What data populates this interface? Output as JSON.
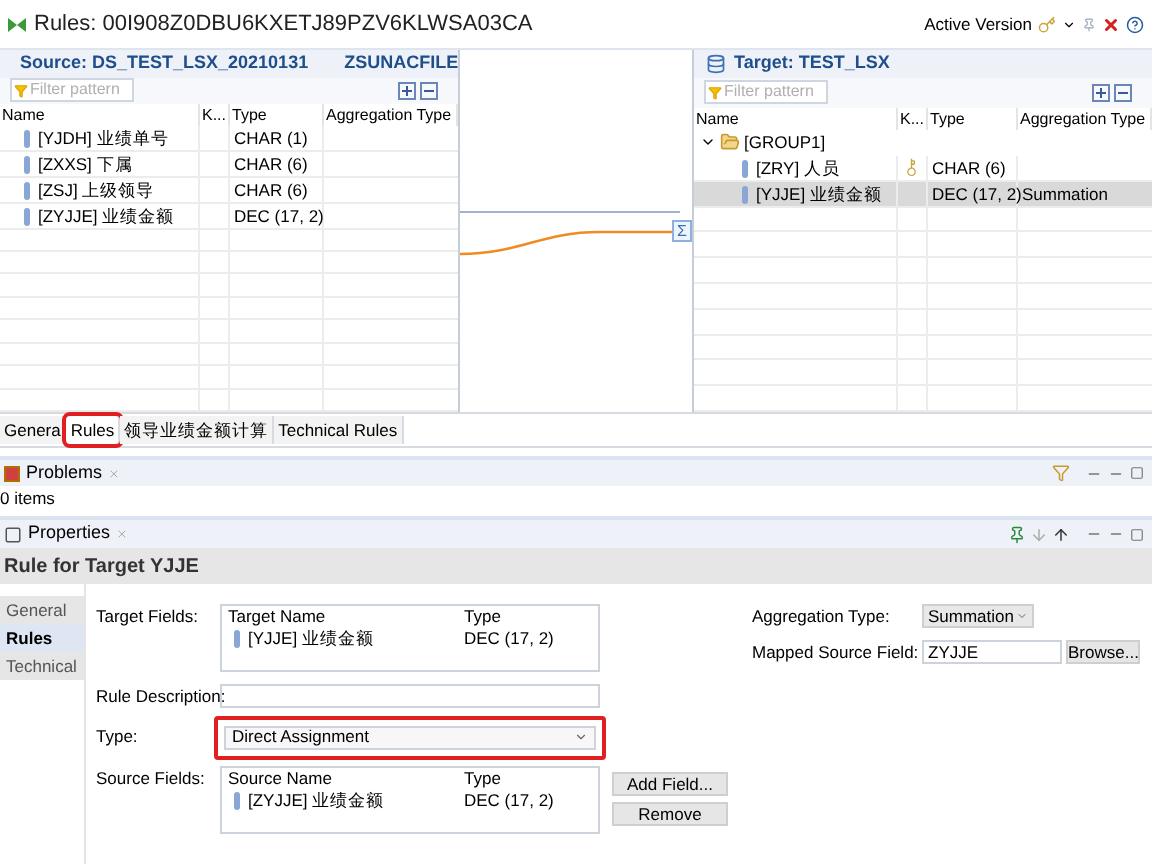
{
  "window": {
    "title": "Rules: 00I908Z0DBU6KXETJ89PZV6KLWSA03CA",
    "version_label": "Active Version"
  },
  "source": {
    "title": "Source: DS_TEST_LSX_20210131",
    "subtitle": "ZSUNACFILE",
    "filter_placeholder": "Filter pattern",
    "columns": [
      "Name",
      "K...",
      "Type",
      "Aggregation Type"
    ],
    "rows": [
      {
        "name": "[YJDH] 业绩单号",
        "type": "CHAR (1)"
      },
      {
        "name": "[ZXXS] 下属",
        "type": "CHAR (6)"
      },
      {
        "name": "[ZSJ] 上级领导",
        "type": "CHAR (6)"
      },
      {
        "name": "[ZYJJE] 业绩金额",
        "type": "DEC (17, 2)"
      }
    ]
  },
  "mapping": {
    "symbol": "Σ"
  },
  "target": {
    "title": "Target: TEST_LSX",
    "filter_placeholder": "Filter pattern",
    "columns": [
      "Name",
      "K...",
      "Type",
      "Aggregation Type"
    ],
    "rows": [
      {
        "name": "[GROUP1]",
        "expanded": true,
        "children": [
          {
            "name": "[ZRY] 人员",
            "key": true,
            "type": "CHAR (6)",
            "selected": false
          },
          {
            "name": "[YJJE] 业绩金额",
            "key": false,
            "type": "DEC (17, 2)",
            "aggregation": "Summation",
            "selected": true
          }
        ]
      }
    ]
  },
  "editor_tabs": [
    {
      "label": "Genera",
      "selected": false,
      "highlighted": false
    },
    {
      "label": "Rules",
      "selected": true,
      "highlighted": true
    },
    {
      "label": "领导业绩金额计算",
      "selected": false,
      "highlighted": false
    },
    {
      "label": "Technical Rules",
      "selected": false,
      "highlighted": false
    }
  ],
  "problems": {
    "title": "Problems",
    "status": "0 items"
  },
  "properties": {
    "title": "Properties",
    "heading": "Rule for Target YJJE",
    "tabs": [
      {
        "label": "General",
        "selected": false
      },
      {
        "label": "Rules",
        "selected": true
      },
      {
        "label": "Technical",
        "selected": false
      }
    ],
    "target_fields": {
      "label": "Target Fields:",
      "columns": [
        "Target Name",
        "Type"
      ],
      "rows": [
        {
          "name": "[YJJE] 业绩金额",
          "type": "DEC (17, 2)"
        }
      ]
    },
    "rule_description": {
      "label": "Rule Description:"
    },
    "rule_type": {
      "label": "Type:",
      "value": "Direct Assignment",
      "highlighted": true
    },
    "source_fields": {
      "label": "Source Fields:",
      "columns": [
        "Source Name",
        "Type"
      ],
      "rows": [
        {
          "name": "[ZYJJE] 业绩金额",
          "type": "DEC (17, 2)"
        }
      ]
    },
    "buttons": [
      "Add Field...",
      "Remove"
    ],
    "aggregation_type": {
      "label": "Aggregation Type:",
      "value": "Summation"
    },
    "mapped_source_field": {
      "label": "Mapped Source Field:",
      "value": "ZYJJE",
      "button": "Browse..."
    }
  }
}
